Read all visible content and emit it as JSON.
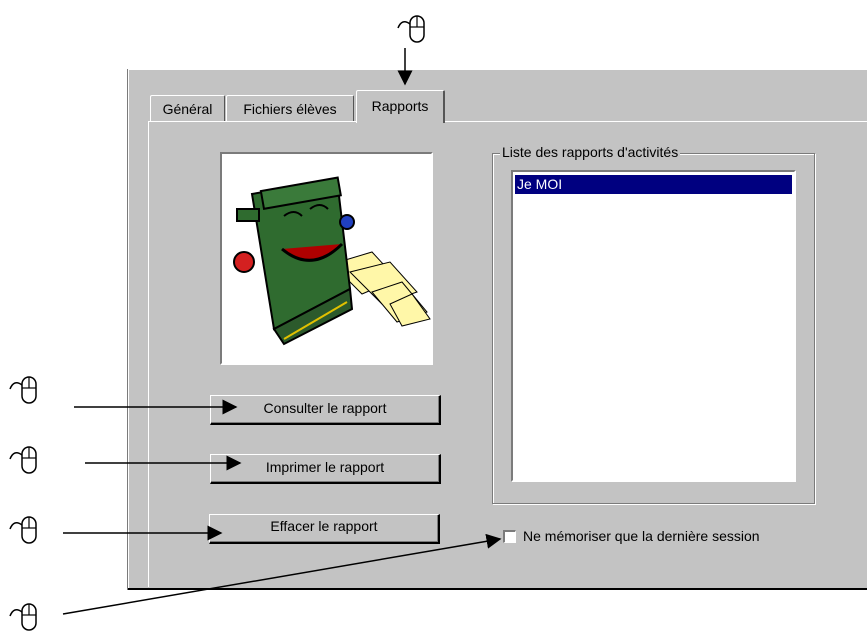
{
  "tabs": [
    {
      "label": "Général"
    },
    {
      "label": "Fichiers élèves"
    },
    {
      "label": "Rapports",
      "active": true
    }
  ],
  "buttons": {
    "consulter": "Consulter le rapport",
    "imprimer": "Imprimer le rapport",
    "effacer": "Effacer le rapport"
  },
  "group": {
    "title": "Liste des rapports d'activités",
    "items": [
      {
        "label": "Je MOI",
        "selected": true
      }
    ]
  },
  "checkbox": {
    "label": "Ne mémoriser que la dernière session",
    "checked": false
  },
  "colors": {
    "window_bg": "#c3c3c3",
    "selection": "#000080"
  },
  "icons": [
    "mouse-click-icon",
    "typewriter-illustration"
  ]
}
